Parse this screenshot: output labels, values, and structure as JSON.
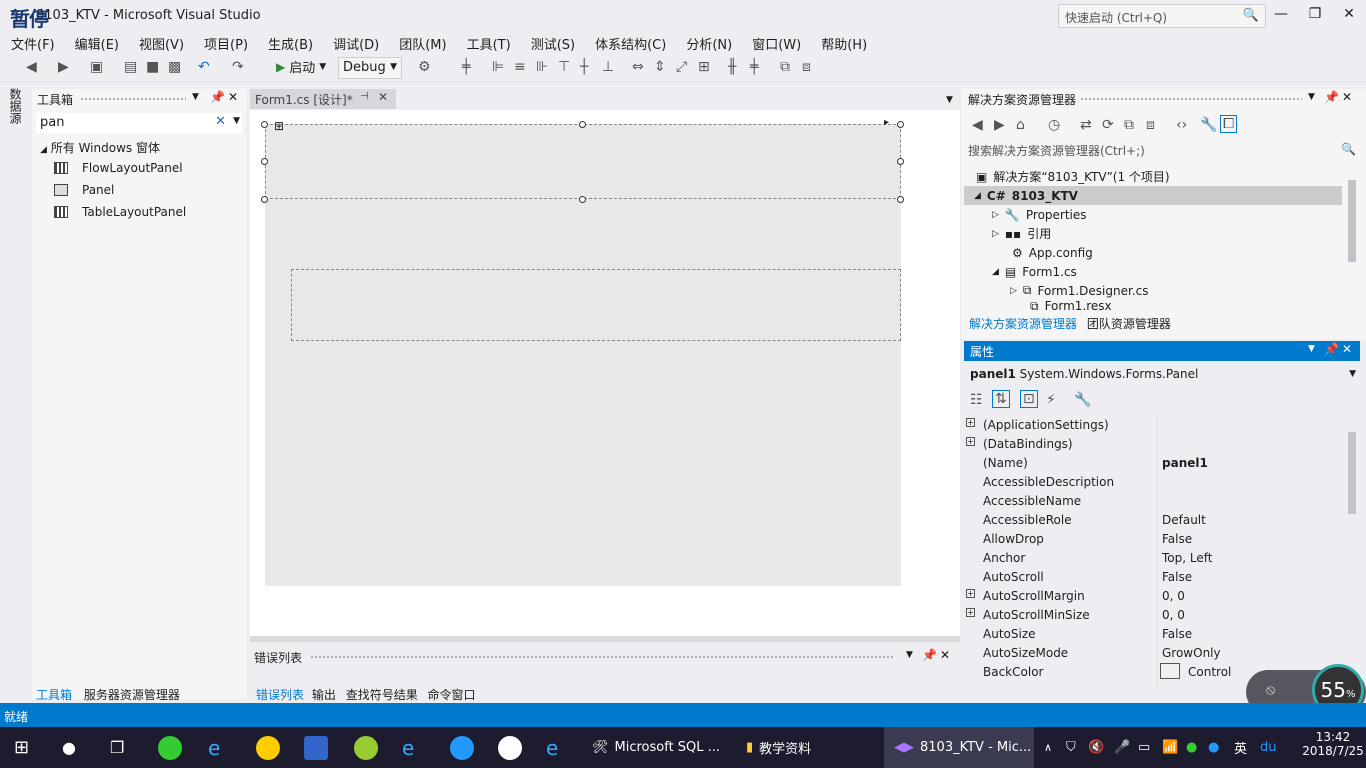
{
  "title": {
    "paused": "暂停",
    "window_title": "8103_KTV - Microsoft Visual Studio",
    "quick_launch_placeholder": "快速启动 (Ctrl+Q)"
  },
  "menu": [
    "文件(F)",
    "编辑(E)",
    "视图(V)",
    "项目(P)",
    "生成(B)",
    "调试(D)",
    "团队(M)",
    "工具(T)",
    "测试(S)",
    "体系结构(C)",
    "分析(N)",
    "窗口(W)",
    "帮助(H)"
  ],
  "toolbar": {
    "start_label": "启动",
    "config": "Debug"
  },
  "left_tab": "数据源",
  "toolbox": {
    "title": "工具箱",
    "search_value": "pan",
    "group": "所有 Windows 窗体",
    "items": [
      "FlowLayoutPanel",
      "Panel",
      "TableLayoutPanel"
    ],
    "tabs": [
      "工具箱",
      "服务器资源管理器"
    ]
  },
  "designer": {
    "tab_label": "Form1.cs [设计]*"
  },
  "error_panel": {
    "title": "错误列表",
    "tabs": [
      "错误列表",
      "输出",
      "查找符号结果",
      "命令窗口"
    ]
  },
  "solution": {
    "title": "解决方案资源管理器",
    "search_placeholder": "搜索解决方案资源管理器(Ctrl+;)",
    "nodes": [
      "解决方案“8103_KTV”(1 个项目)",
      "8103_KTV",
      "Properties",
      "引用",
      "App.config",
      "Form1.cs",
      "Form1.Designer.cs",
      "Form1.resx"
    ],
    "tabs": [
      "解决方案资源管理器",
      "团队资源管理器"
    ]
  },
  "properties": {
    "title": "属性",
    "object_name": "panel1",
    "object_type": "System.Windows.Forms.Panel",
    "rows": [
      {
        "name": "(ApplicationSettings)",
        "value": ""
      },
      {
        "name": "(DataBindings)",
        "value": ""
      },
      {
        "name": "(Name)",
        "value": "panel1"
      },
      {
        "name": "AccessibleDescription",
        "value": ""
      },
      {
        "name": "AccessibleName",
        "value": ""
      },
      {
        "name": "AccessibleRole",
        "value": "Default"
      },
      {
        "name": "AllowDrop",
        "value": "False"
      },
      {
        "name": "Anchor",
        "value": "Top, Left"
      },
      {
        "name": "AutoScroll",
        "value": "False"
      },
      {
        "name": "AutoScrollMargin",
        "value": "0, 0"
      },
      {
        "name": "AutoScrollMinSize",
        "value": "0, 0"
      },
      {
        "name": "AutoSize",
        "value": "False"
      },
      {
        "name": "AutoSizeMode",
        "value": "GrowOnly"
      },
      {
        "name": "BackColor",
        "value": "Control"
      }
    ]
  },
  "status": "就绪",
  "taskbar": {
    "apps": [
      "Microsoft SQL ...",
      "教学资料",
      "8103_KTV - Mic..."
    ],
    "ime": "英",
    "time": "13:42",
    "date": "2018/7/25"
  },
  "net_widget": {
    "percent": "55"
  },
  "colors": {
    "accent": "#007acc",
    "taskbar": "#1c1c2e"
  }
}
